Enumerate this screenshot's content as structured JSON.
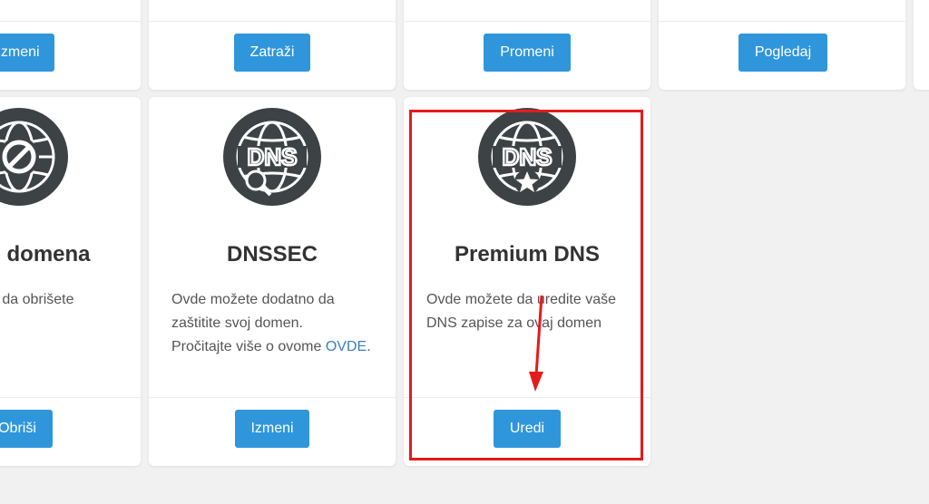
{
  "top_row": {
    "buttons": [
      "Izmeni",
      "Zatraži",
      "Promeni",
      "Pogledaj"
    ]
  },
  "cards": [
    {
      "icon": "globe-ban-icon",
      "title": "Brisanje domena",
      "title_visible": "e domena",
      "desc_visible": "e da obrišete",
      "button": "Obriši"
    },
    {
      "icon": "globe-dns-search-icon",
      "title": "DNSSEC",
      "desc_lines": [
        "Ovde možete dodatno da",
        "zaštitite svoj domen.",
        "Pročitajte više o ovome "
      ],
      "link": "OVDE",
      "link_suffix": ".",
      "button": "Izmeni"
    },
    {
      "icon": "globe-dns-star-icon",
      "title": "Premium DNS",
      "desc_lines": [
        "Ovde možete da uredite vaše",
        "DNS zapise za ovaj domen"
      ],
      "button": "Uredi"
    }
  ],
  "icon_text": "DNS",
  "colors": {
    "accent": "#2f96dc",
    "icon": "#3d4345",
    "highlight": "#e51b1b"
  }
}
